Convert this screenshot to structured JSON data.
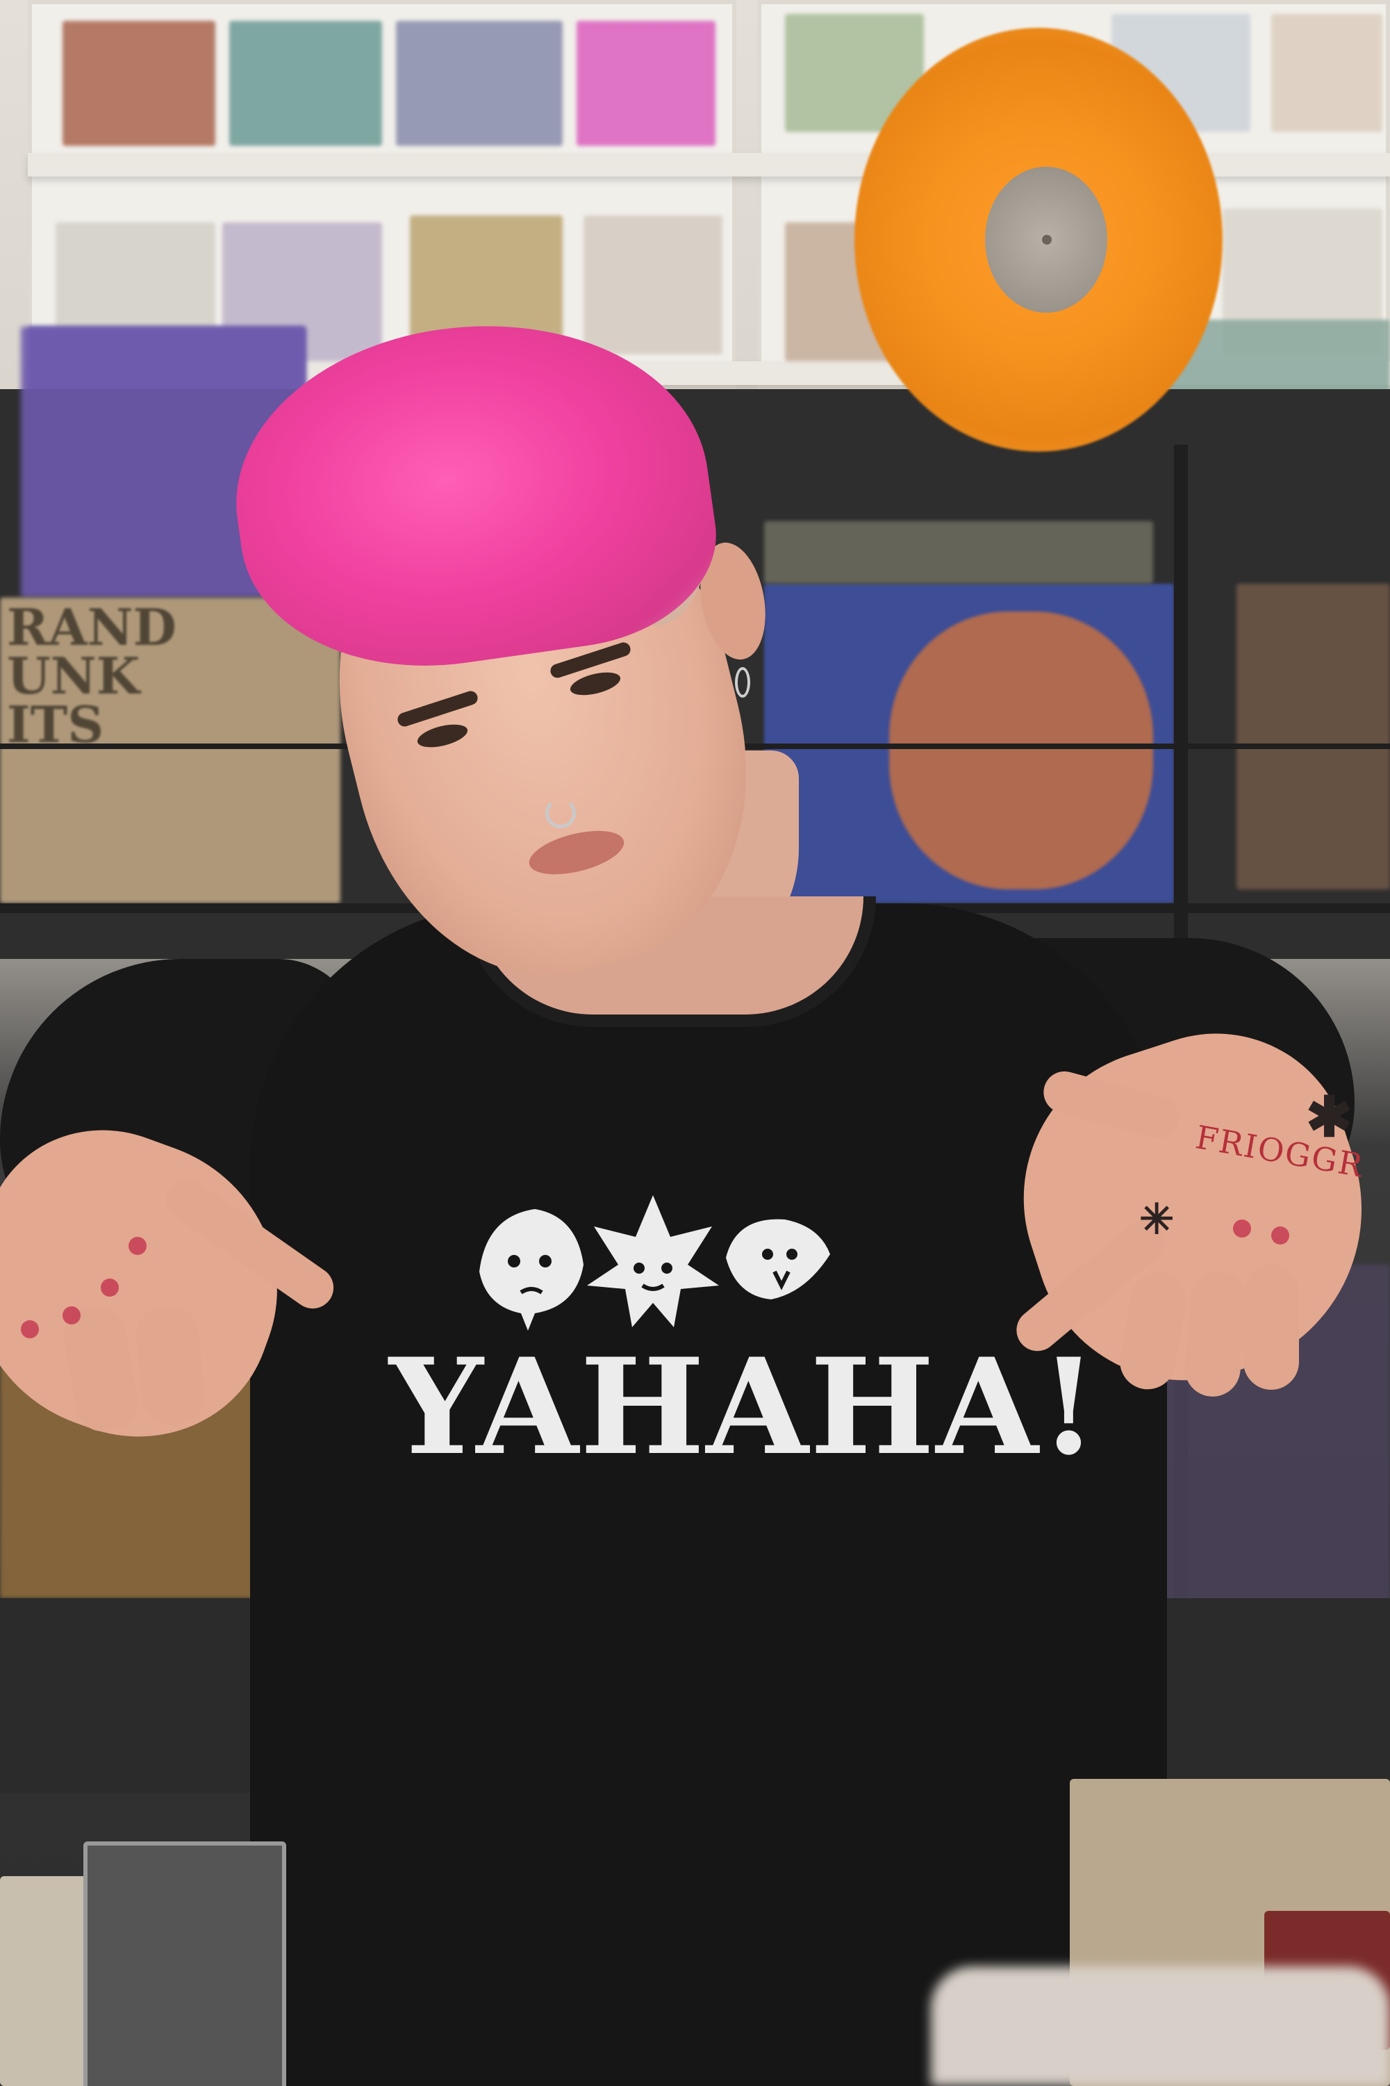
{
  "scene": {
    "description_colors": {
      "hair": "#f0409f",
      "shirt": "#161616",
      "vinyl": "#f6921e",
      "print": "#ececec",
      "tattoo_red": "#b5303a"
    }
  },
  "shirt_print": {
    "text": "YAHAHA!",
    "icons": [
      "leaf-face-icon",
      "maple-leaf-face-icon",
      "leaf-face-icon"
    ]
  },
  "hand_tattoo": {
    "text": "FRIOGGR"
  },
  "background_sleeves": {
    "left_sleeve_lines": [
      "RAND",
      "UNK",
      "ITS"
    ]
  }
}
